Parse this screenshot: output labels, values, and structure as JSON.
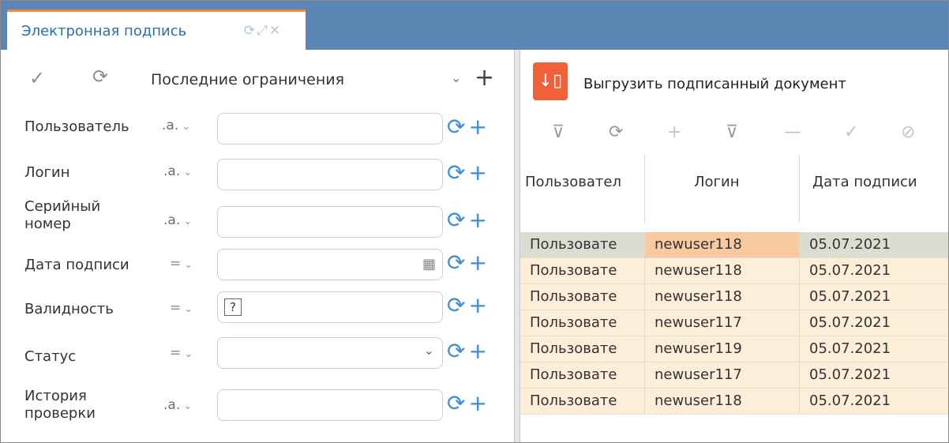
{
  "tab": {
    "title": "Электронная подпись",
    "icons": "⟳⤢✕"
  },
  "filter_panel": {
    "apply_icon": "check-icon",
    "refresh_icon": "refresh-icon",
    "preset": "Последние ограничения",
    "fields": [
      {
        "label": "Пользователь",
        "op": ".a.",
        "value": ""
      },
      {
        "label": "Логин",
        "op": ".a.",
        "value": ""
      },
      {
        "label": "Серийный номер",
        "op": ".a.",
        "value": ""
      },
      {
        "label": "Дата подписи",
        "op": "=",
        "value": ""
      },
      {
        "label": "Валидность",
        "op": "=",
        "value": "?"
      },
      {
        "label": "Статус",
        "op": "=",
        "value": ""
      },
      {
        "label": "История проверки",
        "op": ".a.",
        "value": ""
      }
    ]
  },
  "toolbar": {
    "export_label": "Выгрузить подписанный документ"
  },
  "grid": {
    "columns": [
      "Пользовател",
      "Логин",
      "Дата подписи"
    ],
    "rows": [
      [
        "Пользовате",
        "newuser118",
        "05.07.2021"
      ],
      [
        "Пользовате",
        "newuser118",
        "05.07.2021"
      ],
      [
        "Пользовате",
        "newuser118",
        "05.07.2021"
      ],
      [
        "Пользовате",
        "newuser117",
        "05.07.2021"
      ],
      [
        "Пользовате",
        "newuser119",
        "05.07.2021"
      ],
      [
        "Пользовате",
        "newuser117",
        "05.07.2021"
      ],
      [
        "Пользовате",
        "newuser118",
        "05.07.2021"
      ]
    ]
  },
  "colors": {
    "accent": "#3e8ed8",
    "header_bar": "#5b86b3",
    "tab_top": "#f08a3c",
    "export": "#f0613a",
    "row": "#fdeed8"
  }
}
